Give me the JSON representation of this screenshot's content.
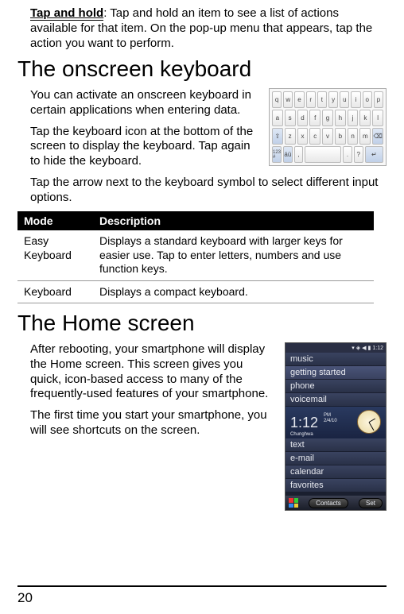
{
  "intro": {
    "taphold_lead": "Tap and hold",
    "taphold_rest": ": Tap and hold an item to see a list of actions available for that item. On the pop-up menu that appears, tap the action you want to perform."
  },
  "kbd_section": {
    "heading": "The onscreen keyboard",
    "p1": "You can activate an onscreen keyboard in certain applications when entering data.",
    "p2": "Tap the keyboard icon at the bottom of the screen to display the keyboard. Tap again to hide the keyboard.",
    "p3": "Tap the arrow next to the keyboard symbol to select different input options.",
    "keys": {
      "r1": [
        "q",
        "w",
        "e",
        "r",
        "t",
        "y",
        "u",
        "i",
        "o",
        "p"
      ],
      "r2": [
        "a",
        "s",
        "d",
        "f",
        "g",
        "h",
        "j",
        "k",
        "l"
      ],
      "r3": [
        "⇧",
        "z",
        "x",
        "c",
        "v",
        "b",
        "n",
        "m",
        "⌫"
      ],
      "r4": [
        "123 #",
        "áü",
        ",",
        "",
        ".",
        "?",
        "↵"
      ]
    }
  },
  "mode_table": {
    "h1": "Mode",
    "h2": "Description",
    "rows": [
      {
        "mode": "Easy Keyboard",
        "desc": "Displays a standard keyboard with larger keys for easier use. Tap to enter letters, numbers and use function keys."
      },
      {
        "mode": "Keyboard",
        "desc": "Displays a compact keyboard."
      }
    ]
  },
  "home_section": {
    "heading": "The Home screen",
    "p1": "After rebooting, your smartphone will display the Home screen. This screen gives you quick, icon-based access to many of the frequently-used features of your smartphone.",
    "p2": "The first time you start your smartphone, you will see shortcuts on the screen."
  },
  "phone": {
    "status_time": "1:12",
    "items_top": [
      "music",
      "getting started",
      "phone",
      "voicemail"
    ],
    "clock_time": "1:12",
    "clock_ampm": "PM",
    "clock_date": "2/4/10",
    "carrier": "Chunghwa",
    "items_bottom": [
      "text",
      "e-mail",
      "calendar",
      "favorites"
    ],
    "soft_left": "Contacts",
    "soft_right": "Set"
  },
  "page_number": "20"
}
